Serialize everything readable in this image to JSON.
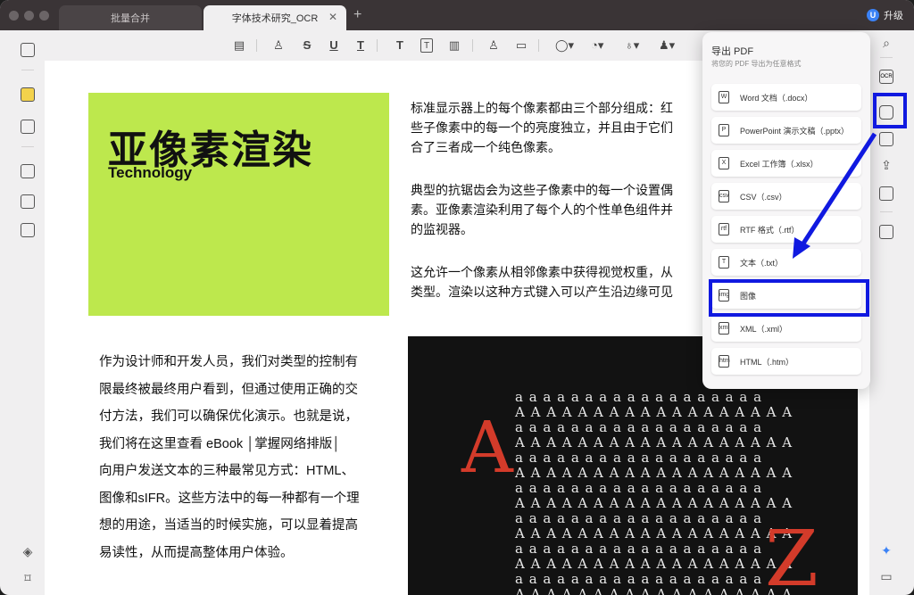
{
  "tabs": [
    {
      "label": "批量合并"
    },
    {
      "label": "字体技术研究_OCR"
    }
  ],
  "upgrade_label": "升级",
  "document": {
    "hero_title": "亚像素渲染",
    "hero_subtitle": "Technology",
    "para1": [
      "标准显示器上的每个像素都由三个部分组成：红",
      "些子像素中的每一个的亮度独立，并且由于它们",
      "合了三者成一个纯色像素。"
    ],
    "para2": [
      "典型的抗锯齿会为这些子像素中的每一个设置偶",
      "素。亚像素渲染利用了每个人的个性单色组件并",
      "的监视器。"
    ],
    "para3": [
      "这允许一个像素从相邻像素中获得视觉权重，从",
      "类型。渲染以这种方式键入可以产生沿边缘可见"
    ],
    "left_para": [
      "作为设计师和开发人员，我们对类型的控制有",
      "限最终被最终用户看到，但通过使用正确的交",
      "付方法，我们可以确保优化演示。也就是说，",
      "我们将在这里查看 eBook │掌握网络排版│",
      "向用户发送文本的三种最常见方式：HTML、",
      "图像和sIFR。这些方法中的每一种都有一个理",
      "想的用途，当适当的时候实施，可以显着提高",
      "易读性，从而提高整体用户体验。"
    ],
    "photo_letters": {
      "big1": "A",
      "big2": "Z",
      "small": "a",
      "caps": "A"
    }
  },
  "export_panel": {
    "title": "导出 PDF",
    "subtitle": "将您的 PDF 导出为任意格式",
    "items": [
      {
        "label": "Word 文档（.docx）",
        "icon": "W"
      },
      {
        "label": "PowerPoint 演示文稿（.pptx）",
        "icon": "P"
      },
      {
        "label": "Excel 工作簿（.xlsx）",
        "icon": "X"
      },
      {
        "label": "CSV（.csv）",
        "icon": "csv"
      },
      {
        "label": "RTF 格式（.rtf）",
        "icon": "rtf"
      },
      {
        "label": "文本（.txt）",
        "icon": "T"
      },
      {
        "label": "图像",
        "icon": "img"
      },
      {
        "label": "XML（.xml）",
        "icon": "xml"
      },
      {
        "label": "HTML（.htm）",
        "icon": "htm"
      }
    ]
  },
  "colors": {
    "hero_bg": "#bde84d",
    "highlight": "#1019e0",
    "accent_red": "#d33b2a"
  }
}
